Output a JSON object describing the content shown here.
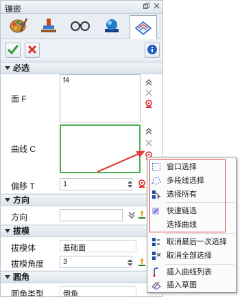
{
  "window": {
    "title": "镶嵌"
  },
  "tabs": [
    {
      "icon": "paint-palette-icon"
    },
    {
      "icon": "stamp-icon"
    },
    {
      "icon": "glasses-icon"
    },
    {
      "icon": "sphere-icon"
    },
    {
      "icon": "inlay-surface-icon",
      "active": true
    }
  ],
  "toolbar": {
    "ok_icon": "checkmark-icon",
    "cancel_icon": "close-icon",
    "info_icon": "info-icon"
  },
  "sections": {
    "required": {
      "title": "必选",
      "face": {
        "label": "面 F",
        "value": "f4"
      },
      "curve": {
        "label": "曲线 C",
        "value": ""
      },
      "offset": {
        "label": "偏移 T",
        "value": "1"
      }
    },
    "direction": {
      "title": "方向",
      "field_label": "方向",
      "value": ""
    },
    "draft": {
      "title": "拔模",
      "body_label": "拔模体",
      "body_value": "基础面",
      "angle_label": "拔模角度",
      "angle_value": "3"
    },
    "fillet": {
      "title": "圆角",
      "type_label": "圆角类型",
      "type_value": "倒角"
    }
  },
  "context_menu": {
    "items": [
      {
        "label": "窗口选择",
        "icon": "window-select-icon"
      },
      {
        "label": "多段线选择",
        "icon": "polyline-select-icon"
      },
      {
        "label": "选择所有",
        "icon": "select-all-icon"
      },
      {
        "label": "快速链选",
        "icon": "quick-chain-icon"
      },
      {
        "label": "选择曲线",
        "icon": "select-curve-icon"
      },
      {
        "label": "取消最后一次选择",
        "icon": "undo-last-select-icon"
      },
      {
        "label": "取消全部选择",
        "icon": "clear-all-select-icon"
      },
      {
        "label": "插入曲线列表",
        "icon": "insert-curve-list-icon"
      },
      {
        "label": "插入草图",
        "icon": "insert-sketch-icon"
      }
    ]
  },
  "colors": {
    "annotation_red": "#e03b3b",
    "accent_green": "#4caf50",
    "ok_green": "#2e9d2e",
    "cancel_red": "#d9312d",
    "info_blue": "#1d5fc2"
  }
}
